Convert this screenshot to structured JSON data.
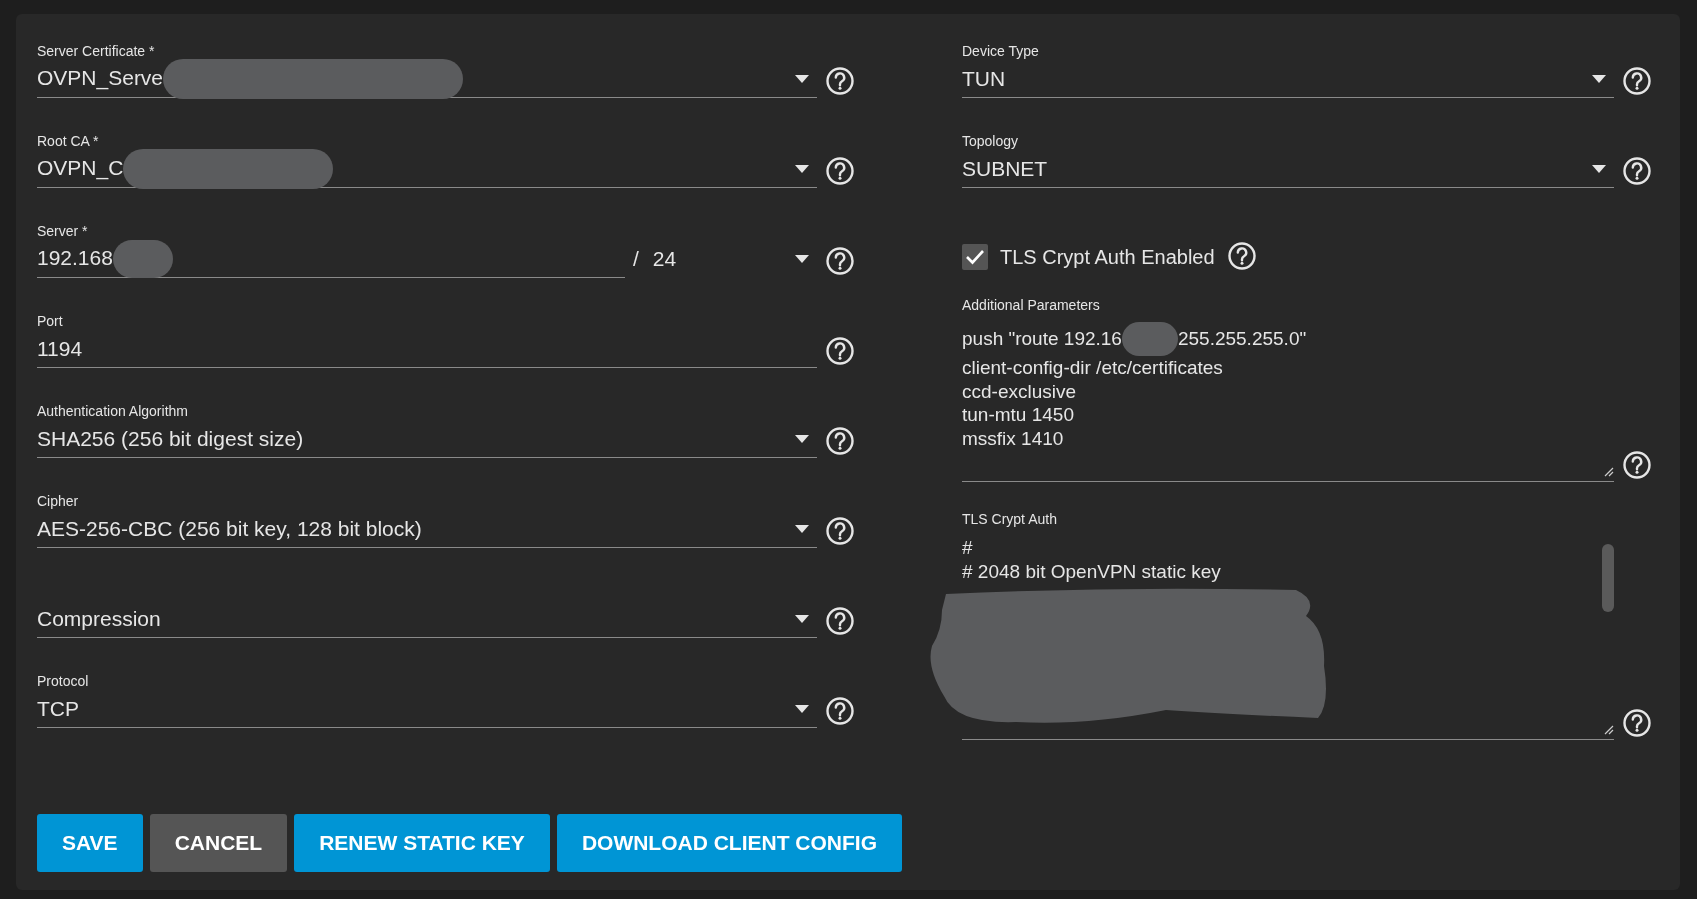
{
  "left_fields": [
    {
      "kind": "select",
      "label": "Server Certificate *",
      "value": "OVPN_Serve",
      "redacted": true
    },
    {
      "kind": "select",
      "label": "Root CA *",
      "value": "OVPN_C",
      "redacted": true
    },
    {
      "kind": "network",
      "label": "Server *",
      "value": "192.168",
      "redacted": true,
      "separator": "/",
      "mask": "24"
    },
    {
      "kind": "text",
      "label": "Port",
      "value": "1194"
    },
    {
      "kind": "select",
      "label": "Authentication Algorithm",
      "value": "SHA256 (256 bit digest size)"
    },
    {
      "kind": "select",
      "label": "Cipher",
      "value": "AES-256-CBC (256 bit key, 128 bit block)"
    },
    {
      "kind": "select",
      "placeholder": "Compression"
    },
    {
      "kind": "select",
      "label": "Protocol",
      "value": "TCP"
    }
  ],
  "right_fields": [
    {
      "kind": "select",
      "label": "Device Type",
      "value": "TUN"
    },
    {
      "kind": "select",
      "label": "Topology",
      "value": "SUBNET"
    },
    {
      "kind": "checkbox",
      "label": "TLS Crypt Auth Enabled",
      "checked": true
    },
    {
      "kind": "textarea",
      "label": "Additional Parameters",
      "lines": [
        {
          "parts": [
            "push \"route 192.16",
            "255.255.255.0\""
          ]
        },
        {
          "parts": [
            "client-config-dir /etc/certificates"
          ]
        },
        {
          "parts": [
            "ccd-exclusive"
          ]
        },
        {
          "parts": [
            "tun-mtu 1450"
          ]
        },
        {
          "parts": [
            "mssfix 1410"
          ]
        }
      ]
    },
    {
      "kind": "textarea",
      "label": "TLS Crypt Auth",
      "lines": [
        {
          "parts": [
            "#"
          ]
        },
        {
          "parts": [
            "# 2048 bit OpenVPN static key"
          ]
        }
      ],
      "redacted": true,
      "scrollable": true
    }
  ],
  "buttons": [
    {
      "label": "SAVE",
      "kind": "primary"
    },
    {
      "label": "CANCEL",
      "kind": "secondary"
    },
    {
      "label": "RENEW STATIC KEY",
      "kind": "primary"
    },
    {
      "label": "DOWNLOAD CLIENT CONFIG",
      "kind": "primary"
    }
  ]
}
